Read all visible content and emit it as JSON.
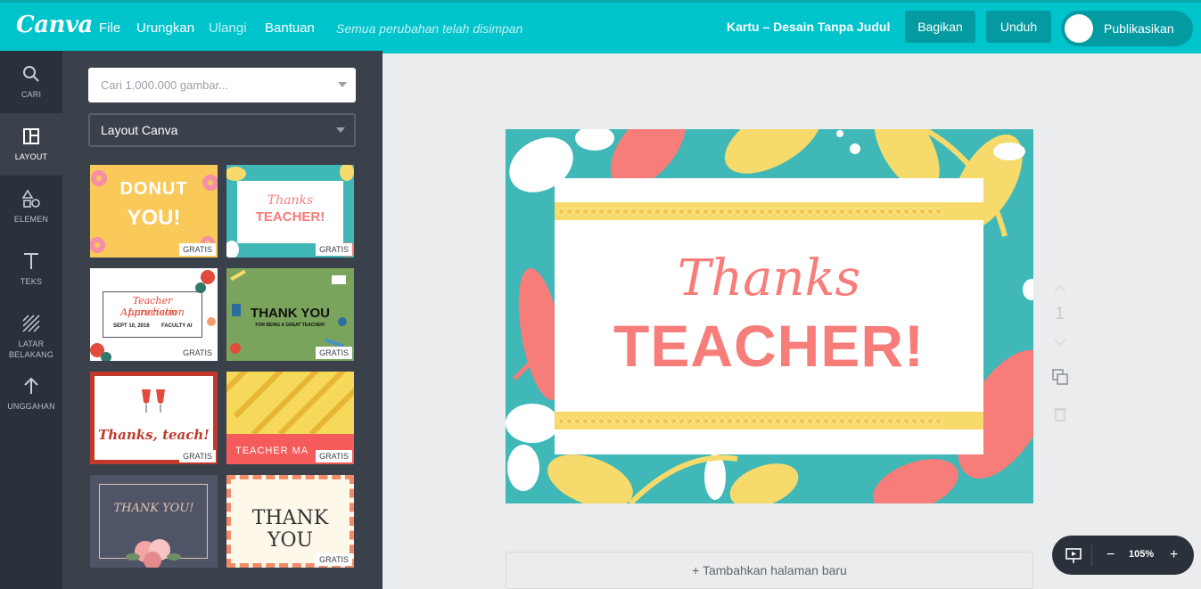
{
  "app": {
    "logo": "Canva"
  },
  "menu": [
    {
      "label": "File",
      "dim": false
    },
    {
      "label": "Urungkan",
      "dim": false
    },
    {
      "label": "Ulangi",
      "dim": true
    },
    {
      "label": "Bantuan",
      "dim": false
    }
  ],
  "save_status": "Semua perubahan telah disimpan",
  "design_title": "Kartu – Desain Tanpa Judul",
  "buttons": {
    "share": "Bagikan",
    "download": "Unduh",
    "publish": "Publikasikan"
  },
  "rail": [
    {
      "label": "CARI",
      "icon": "search-icon"
    },
    {
      "label": "LAYOUT",
      "icon": "layout-icon",
      "active": true
    },
    {
      "label": "ELEMEN",
      "icon": "shapes-icon"
    },
    {
      "label": "TEKS",
      "icon": "text-icon"
    },
    {
      "label": "LATAR BELAKANG",
      "icon": "pattern-icon"
    },
    {
      "label": "UNGGAHAN",
      "icon": "upload-arrow-icon"
    }
  ],
  "panel": {
    "search_placeholder": "Cari 1.000.000 gambar...",
    "layout_select": "Layout Canva",
    "badge": "GRATIS",
    "thumbnails": [
      {
        "name": "donut-you",
        "lines": [
          "DONUT",
          "YOU!"
        ],
        "bg": "#f9c95a",
        "fg": "#ffffff",
        "badge": true
      },
      {
        "name": "thanks-teacher",
        "lines": [
          "Thanks",
          "TEACHER!"
        ],
        "bg": "#3fb8b7",
        "fg": "#f67d79",
        "badge": true
      },
      {
        "name": "teacher-appreciation",
        "lines": [
          "Teacher Appreciation",
          "Luncheon",
          "SEPT 10, 2016",
          "FACULTY AI"
        ],
        "bg": "#ffffff",
        "fg": "#e24a3b",
        "badge": true
      },
      {
        "name": "thank-you-green",
        "lines": [
          "THANK YOU",
          "FOR BEING A GREAT TEACHER!"
        ],
        "bg": "#7aa35c",
        "fg": "#111111",
        "badge": true
      },
      {
        "name": "thanks-teach",
        "lines": [
          "Thanks, teach!"
        ],
        "bg": "#ffffff",
        "fg": "#c0392b",
        "badge": true
      },
      {
        "name": "teacher-pencils",
        "lines": [
          "TEACHER MA"
        ],
        "bg": "#f6d85a",
        "fg": "#ffffff",
        "badge": true
      },
      {
        "name": "thank-you-floral",
        "lines": [
          "THANK YOU!"
        ],
        "bg": "#4f5566",
        "fg": "#e3c3b5",
        "badge": false
      },
      {
        "name": "thank-you-stripes",
        "lines": [
          "THANK YOU"
        ],
        "bg": "#fdf8e9",
        "fg": "#333333",
        "badge": true
      }
    ]
  },
  "card": {
    "line1": "Thanks",
    "line2": "TEACHER!",
    "colors": {
      "teal": "#3fb8b7",
      "coral": "#f67d79",
      "yellow": "#f6da6b"
    }
  },
  "page_controls": {
    "page_number": "1"
  },
  "add_page": "+ Tambahkan halaman baru",
  "zoom": {
    "value": "105%"
  }
}
